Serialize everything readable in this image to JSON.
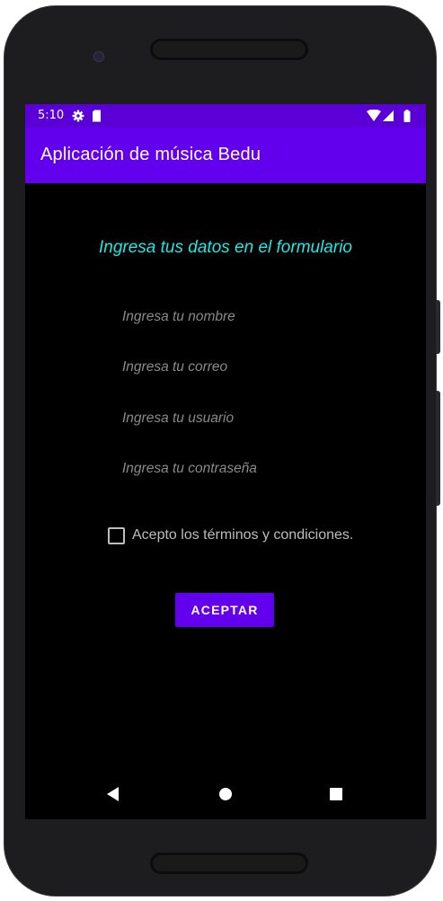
{
  "status_bar": {
    "time": "5:10",
    "icons": [
      "settings-icon",
      "sd-card-icon",
      "wifi-icon",
      "signal-icon",
      "battery-icon"
    ],
    "color": "#5a00d6"
  },
  "app_bar": {
    "title": "Aplicación de música Bedu",
    "color": "#6200ee"
  },
  "form": {
    "heading": "Ingresa tus datos en el formulario",
    "heading_color": "#1de9e6",
    "name_placeholder": "Ingresa tu nombre",
    "email_placeholder": "Ingresa tu correo",
    "username_placeholder": "Ingresa tu usuario",
    "password_placeholder": "Ingresa tu contraseña",
    "terms_label": "Acepto los términos y condiciones.",
    "terms_checked": false,
    "submit_label": "ACEPTAR"
  },
  "nav_bar": {
    "items": [
      "back-icon",
      "home-icon",
      "recents-icon"
    ]
  }
}
